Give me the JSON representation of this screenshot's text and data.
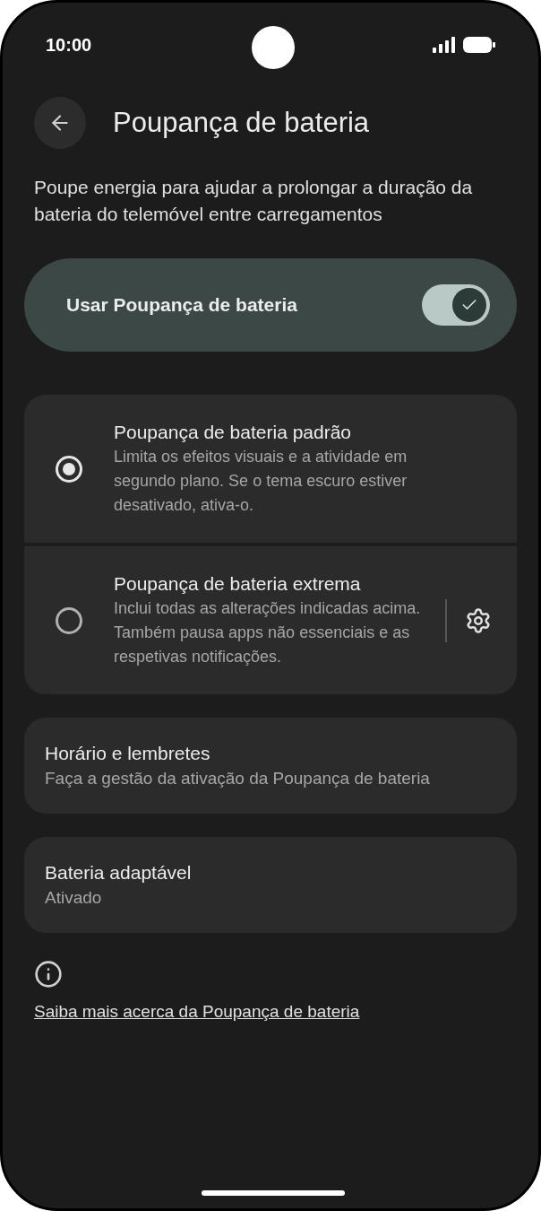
{
  "status_bar": {
    "time": "10:00"
  },
  "header": {
    "title": "Poupança de bateria"
  },
  "description": "Poupe energia para ajudar a prolongar a duração da bateria do telemóvel entre carregamentos",
  "master_switch": {
    "label": "Usar Poupança de bateria",
    "on": true
  },
  "modes": [
    {
      "title": "Poupança de bateria padrão",
      "description": "Limita os efeitos visuais e a atividade em segundo plano. Se o tema escuro estiver desativado, ativa-o.",
      "selected": true,
      "has_settings": false
    },
    {
      "title": "Poupança de bateria extrema",
      "description": "Inclui todas as alterações indicadas acima. Também pausa apps não essenciais e as respetivas notificações.",
      "selected": false,
      "has_settings": true
    }
  ],
  "settings_items": [
    {
      "title": "Horário e lembretes",
      "subtitle": "Faça a gestão da ativação da Poupança de bateria"
    },
    {
      "title": "Bateria adaptável",
      "subtitle": "Ativado"
    }
  ],
  "footer": {
    "link": "Saiba mais acerca da Poupança de bateria"
  }
}
